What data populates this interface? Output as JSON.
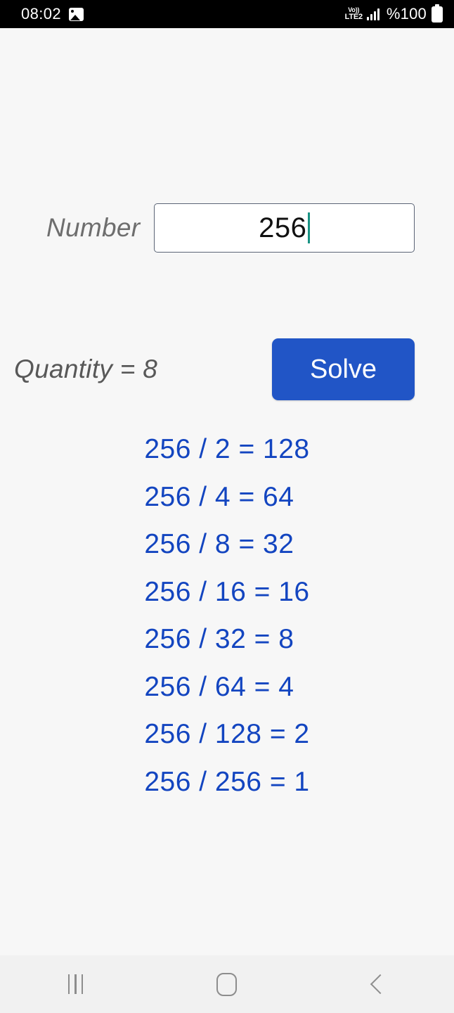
{
  "status_bar": {
    "time": "08:02",
    "photo_icon": "image-icon",
    "network_line1": "Vo))",
    "network_line2": "LTE2",
    "signal_icon": "signal-bars-icon",
    "battery_text": "%100",
    "battery_icon": "battery-full-icon"
  },
  "form": {
    "number_label": "Number",
    "number_value": "256",
    "number_placeholder": "",
    "quantity_label": "Quantity = 8",
    "solve_label": "Solve"
  },
  "results": [
    "256 / 2 = 128",
    "256 / 4 = 64",
    "256 / 8 = 32",
    "256 / 16 = 16",
    "256 / 32 = 8",
    "256 / 64 = 4",
    "256 / 128 = 2",
    "256 / 256 = 1"
  ],
  "nav_bar": {
    "recents_icon": "recents-icon",
    "home_icon": "home-icon",
    "back_icon": "back-icon"
  },
  "colors": {
    "accent_blue": "#2155c6",
    "result_blue": "#1345c0",
    "label_gray": "#6e6e6e",
    "caret_teal": "#1a9384",
    "background": "#f7f7f7",
    "navbar_background": "#f1f1f1"
  }
}
